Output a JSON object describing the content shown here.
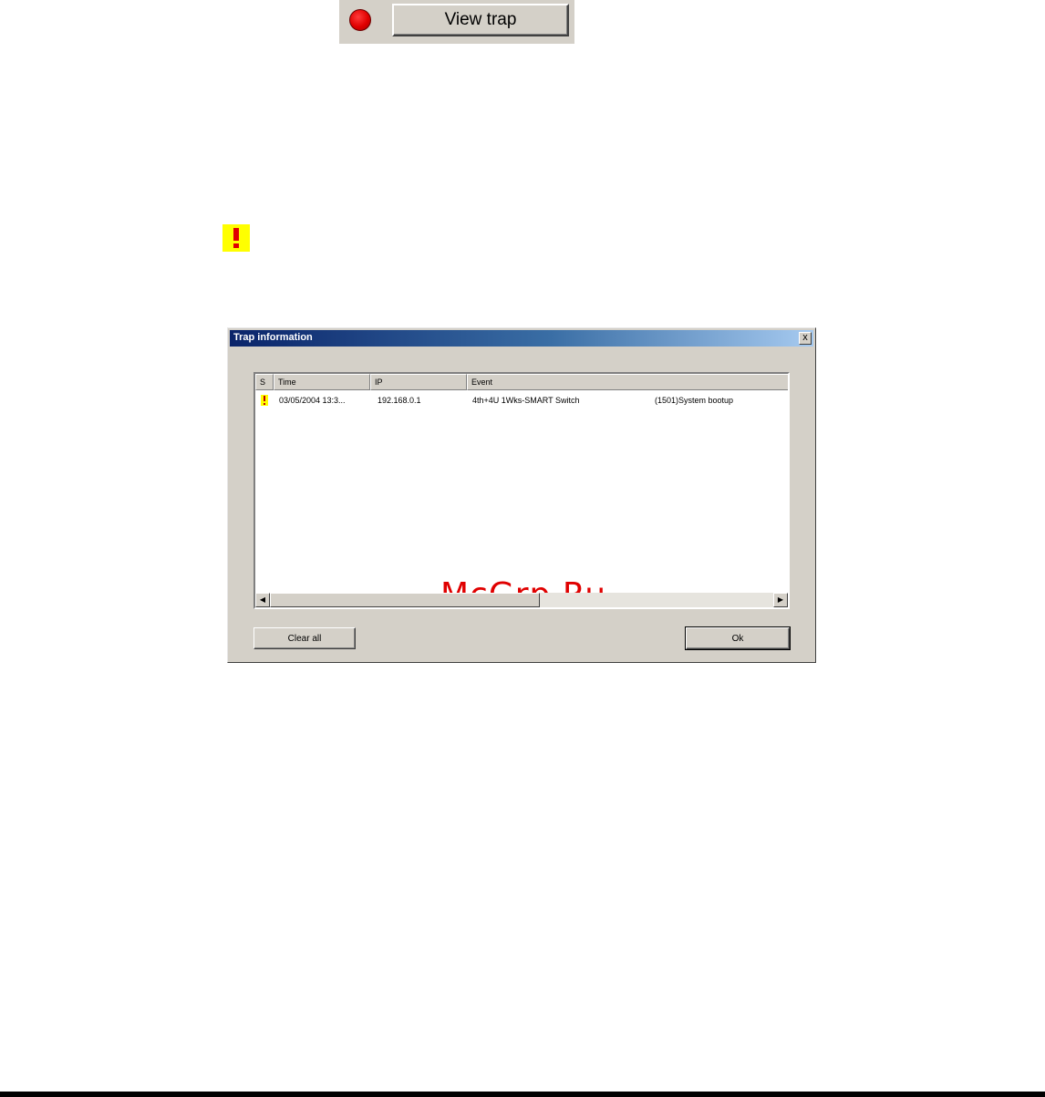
{
  "trap_strip": {
    "button_label": "View trap",
    "indicator_color": "#e00000"
  },
  "warning_icon": {
    "icon": "exclamation-warning-icon",
    "bg_color": "#ffff00",
    "mark_color": "#e00000"
  },
  "dialog": {
    "title": "Trap information",
    "close_label": "x",
    "columns": [
      "S",
      "Time",
      "IP",
      "Event"
    ],
    "rows": [
      {
        "severity_icon": "warning-icon",
        "time": "03/05/2004 13:3...",
        "ip": "192.168.0.1",
        "event": "4th+4U 1Wks-SMART Switch",
        "detail": "(1501)System bootup"
      }
    ],
    "watermark": "McGrp.Ru",
    "clear_label": "Clear all",
    "ok_label": "Ok"
  }
}
